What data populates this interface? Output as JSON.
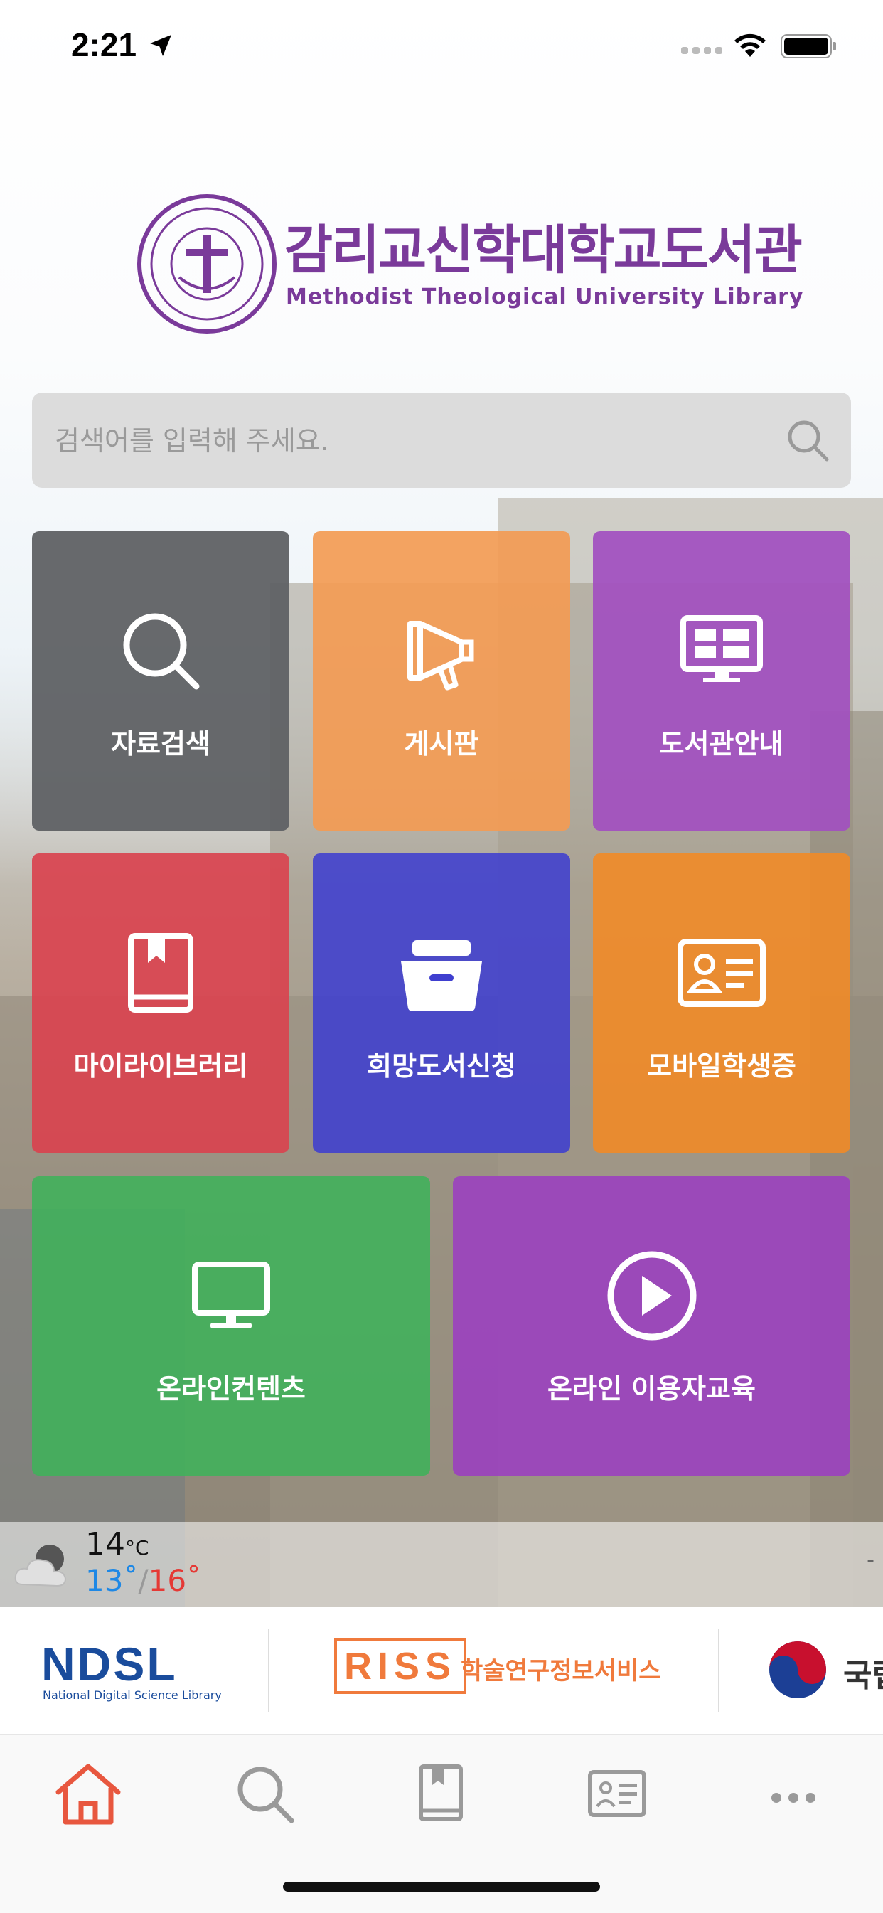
{
  "status_bar": {
    "time": "2:21"
  },
  "logo": {
    "korean_name": "감리교신학대학교도서관",
    "english_name": "Methodist Theological University Library"
  },
  "search": {
    "placeholder": "검색어를 입력해 주세요."
  },
  "tiles": [
    {
      "label": "자료검색",
      "icon": "search-icon",
      "color": "#5f6164"
    },
    {
      "label": "게시판",
      "icon": "megaphone-icon",
      "color": "#f39b54"
    },
    {
      "label": "도서관안내",
      "icon": "monitor-board-icon",
      "color": "#a24fc0"
    },
    {
      "label": "마이라이브러리",
      "icon": "bookmark-book-icon",
      "color": "#d9434f"
    },
    {
      "label": "희망도서신청",
      "icon": "box-icon",
      "color": "#3f3fcf"
    },
    {
      "label": "모바일학생증",
      "icon": "id-card-icon",
      "color": "#f38a24"
    },
    {
      "label": "온라인컨텐츠",
      "icon": "desktop-icon",
      "color": "#3fb25a"
    },
    {
      "label": "온라인 이용자교육",
      "icon": "play-icon",
      "color": "#9b3fc0"
    }
  ],
  "weather": {
    "temp": "14",
    "unit": "°C",
    "low": "13˚",
    "separator": "/",
    "high": "16˚",
    "icon": "cloudy-icon",
    "dash": "-"
  },
  "banners": {
    "ndsl_name": "NDSL",
    "ndsl_sub": "National Digital Science Library",
    "riss_name": "RISS",
    "riss_sub": "학술연구정보서비스",
    "third_partial": "국립"
  },
  "tabbar": {
    "items": [
      "home-icon",
      "search-icon",
      "book-icon",
      "id-card-icon",
      "more-icon"
    ],
    "active_color": "#e8573f",
    "inactive_color": "#9a9a9a"
  }
}
